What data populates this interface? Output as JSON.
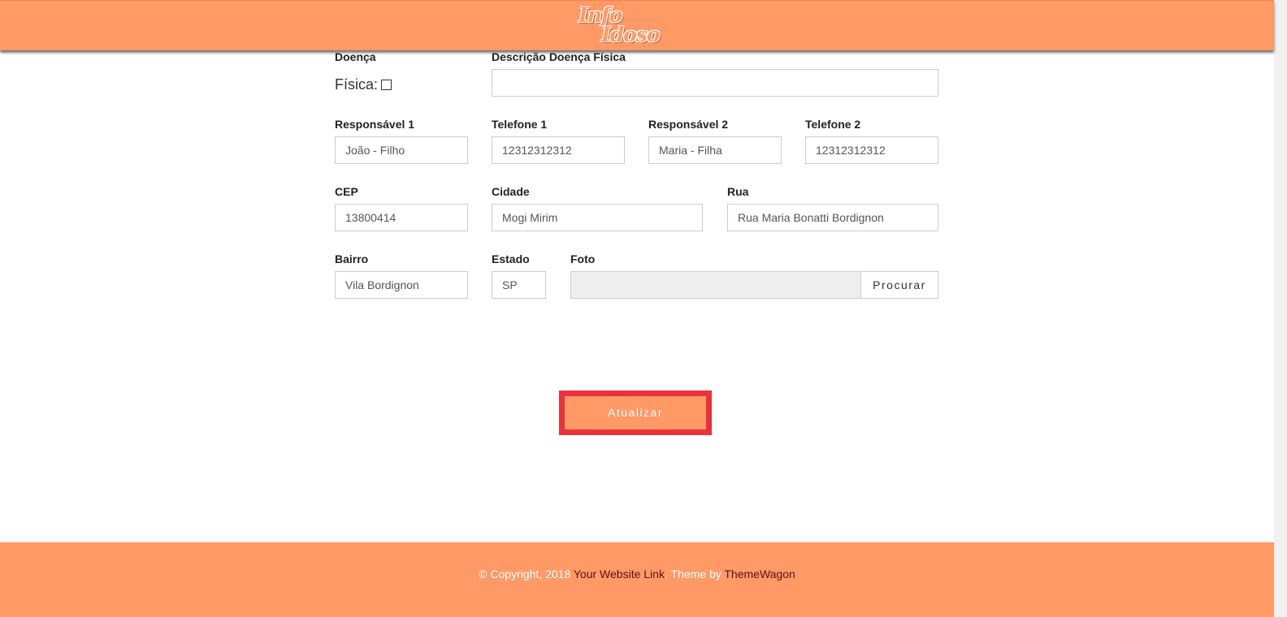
{
  "header": {
    "logo_line1": "Info",
    "logo_line2": "Idoso"
  },
  "form": {
    "doenca_label": "Doença",
    "fisica_label": "Física:",
    "descricao_label": "Descrição Doença Física",
    "descricao_value": "",
    "responsavel1_label": "Responsável 1",
    "responsavel1_value": "João - Filho",
    "telefone1_label": "Telefone 1",
    "telefone1_value": "12312312312",
    "responsavel2_label": "Responsável 2",
    "responsavel2_value": "Maria - Filha",
    "telefone2_label": "Telefone 2",
    "telefone2_value": "12312312312",
    "cep_label": "CEP",
    "cep_value": "13800414",
    "cidade_label": "Cidade",
    "cidade_value": "Mogi Mirim",
    "rua_label": "Rua",
    "rua_value": "Rua Maria Bonatti Bordignon",
    "bairro_label": "Bairro",
    "bairro_value": "Vila Bordignon",
    "estado_label": "Estado",
    "estado_value": "SP",
    "foto_label": "Foto",
    "browse_label": "Procurar",
    "fisica_checked": false
  },
  "actions": {
    "update_label": "Atualizar"
  },
  "footer": {
    "copyright": "© Copyright, 2018",
    "website_link": "Your Website Link",
    "theme_by": ". Theme by",
    "themewagon_link": "ThemeWagon"
  },
  "colors": {
    "brand": "#FF9966",
    "highlight": "#e8323c",
    "footer_link": "#5a0f1f"
  }
}
